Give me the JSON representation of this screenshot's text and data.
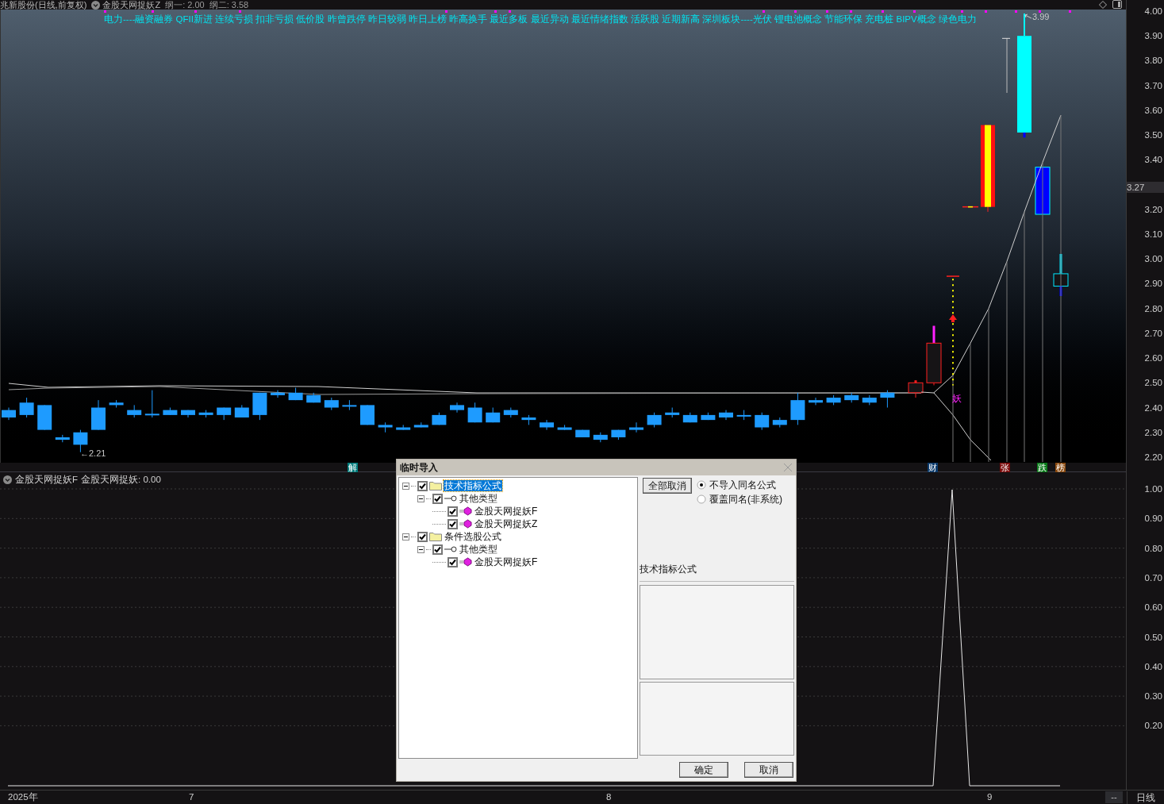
{
  "header": {
    "stock": "兆新股份(日线,前复权)",
    "indicator": "金股天网捉妖Z",
    "readings": [
      "纲一: 2.00",
      "纲二: 3.58"
    ]
  },
  "tag_line": "电力----融资融券 QFII新进 连续亏损 扣非亏损 低价股 昨曾跌停 昨日较弱 昨日上榜 昨高换手 最近多板 最近异动 最近情绪指数 活跃股 近期新高 深圳板块----光伏 锂电池概念 节能环保 充电桩 BIPV概念 绿色电力",
  "price_chart": {
    "high_label": "3.99",
    "low_label": "←2.21",
    "signal_label": "妖",
    "current_price": "3.27",
    "axis": [
      "4.00",
      "3.90",
      "3.80",
      "3.70",
      "3.60",
      "3.50",
      "3.40",
      "3.20",
      "3.10",
      "3.00",
      "2.90",
      "2.80",
      "2.70",
      "2.60",
      "2.50",
      "2.40",
      "2.30",
      "2.20"
    ]
  },
  "event_markers": [
    {
      "text": "解",
      "color": "#007b7b"
    },
    {
      "text": "财",
      "color": "#0b3a6b"
    },
    {
      "text": "张",
      "color": "#7a0a0a"
    },
    {
      "text": "跌",
      "color": "#0a7a1a"
    },
    {
      "text": "榜",
      "color": "#8a4a10"
    }
  ],
  "indicator_panel": {
    "name": "金股天网捉妖F",
    "reading": "金股天网捉妖: 0.00",
    "axis": [
      "1.00",
      "0.90",
      "0.80",
      "0.70",
      "0.60",
      "0.50",
      "0.40",
      "0.30",
      "0.20"
    ]
  },
  "date_axis": [
    "2025年",
    "7",
    "8",
    "9"
  ],
  "status": {
    "dash": "--",
    "period": "日线"
  },
  "dialog": {
    "title": "临时导入",
    "tree": [
      {
        "kind": "folder",
        "label": "技术指标公式",
        "checked": true,
        "selected": true,
        "expanded": true,
        "children": [
          {
            "kind": "type",
            "label": "其他类型",
            "checked": true,
            "selected": false,
            "expanded": true,
            "children": [
              {
                "kind": "formula",
                "label": "金股天网捉妖F",
                "checked": true,
                "selected": false
              },
              {
                "kind": "formula",
                "label": "金股天网捉妖Z",
                "checked": true,
                "selected": false
              }
            ]
          }
        ]
      },
      {
        "kind": "folder",
        "label": "条件选股公式",
        "checked": true,
        "selected": false,
        "expanded": true,
        "children": [
          {
            "kind": "type",
            "label": "其他类型",
            "checked": true,
            "selected": false,
            "expanded": true,
            "children": [
              {
                "kind": "formula",
                "label": "金股天网捉妖F",
                "checked": true,
                "selected": false
              }
            ]
          }
        ]
      }
    ],
    "clear_button": "全部取消",
    "options": [
      {
        "label": "不导入同名公式",
        "selected": true
      },
      {
        "label": "覆盖同名(非系统)",
        "selected": false
      }
    ],
    "section_label": "技术指标公式",
    "ok_button": "确定",
    "cancel_button": "取消"
  }
}
